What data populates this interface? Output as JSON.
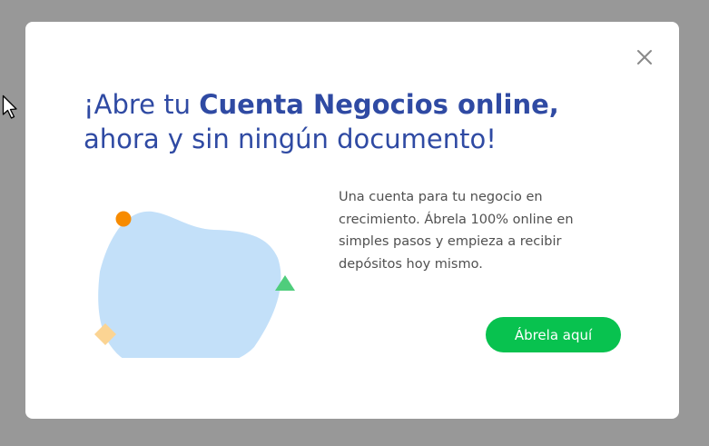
{
  "modal": {
    "title_part1": "¡Abre tu ",
    "title_bold": "Cuenta Negocios online,",
    "title_line2": "ahora y sin ningún documento!",
    "description": "Una cuenta para tu negocio en crecimiento. Ábrela 100% online en simples pasos y empieza a recibir depósitos hoy mismo.",
    "cta_label": "Ábrela aquí",
    "close_icon": "close-icon"
  },
  "colors": {
    "overlay": "#989898",
    "title": "#2f4aa3",
    "cta": "#08c24f",
    "blob": "#c3e0f9",
    "dot": "#f78b00",
    "triangle": "#4fcd7c",
    "diamond": "#fbd493"
  }
}
